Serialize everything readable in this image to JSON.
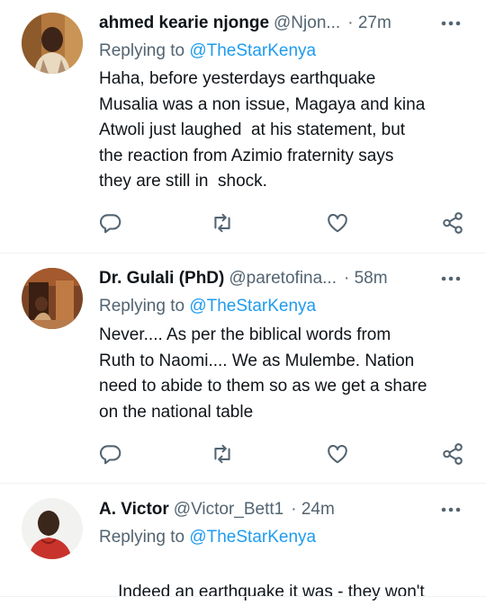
{
  "tweets": [
    {
      "name": "ahmed kearie njonge",
      "handle": "@Njon...",
      "time": "· 27m",
      "replying_prefix": "Replying to",
      "replying_handle": "@TheStarKenya",
      "text": "Haha, before yesterdays earthquake\nMusalia was a non issue, Magaya and kina\nAtwoli just laughed  at his statement, but\nthe reaction from Azimio fraternity says\nthey are still in  shock."
    },
    {
      "name": "Dr. Gulali (PhD)",
      "handle": "@paretofina...",
      "time": "· 58m",
      "replying_prefix": "Replying to",
      "replying_handle": "@TheStarKenya",
      "text": "Never.... As per the biblical words from\nRuth to Naomi.... We as Mulembe. Nation\nneed to abide to them so as we get a share\non the national table"
    },
    {
      "name": "A. Victor",
      "handle": "@Victor_Bett1",
      "time": "· 24m",
      "replying_prefix": "Replying to",
      "replying_handle": "@TheStarKenya",
      "text": "Indeed an earthquake it was - they won't\nstop talking"
    }
  ],
  "icons": {
    "more": "more-icon",
    "reply": "reply-icon",
    "retweet": "retweet-icon",
    "like": "heart-icon",
    "share": "share-icon"
  },
  "colors": {
    "accent": "#1d9bf0",
    "secondary_text": "#536471",
    "primary_text": "#0f1419",
    "divider": "#eff3f4"
  }
}
